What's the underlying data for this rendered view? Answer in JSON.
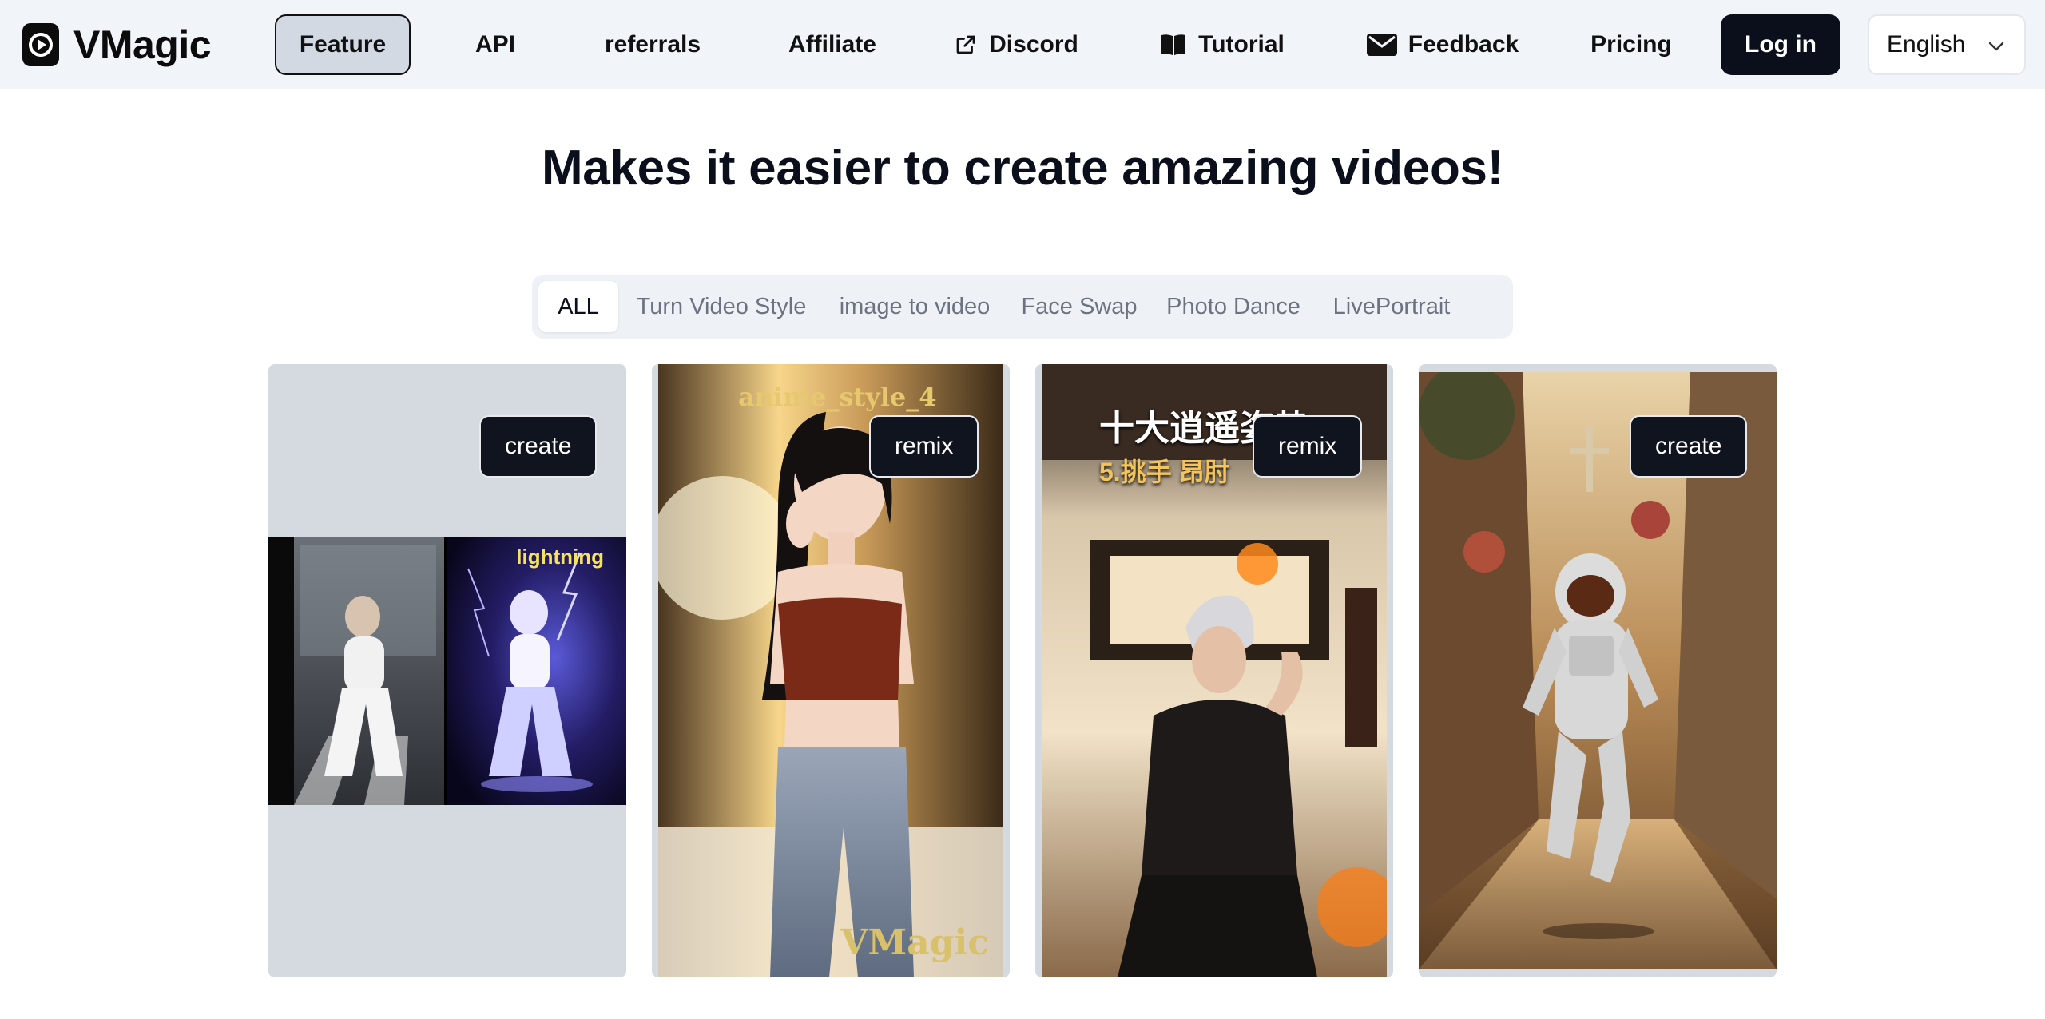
{
  "header": {
    "brand": "VMagic",
    "nav": [
      {
        "label": "Feature",
        "icon": ""
      },
      {
        "label": "API",
        "icon": ""
      },
      {
        "label": "referrals",
        "icon": ""
      },
      {
        "label": "Affiliate",
        "icon": ""
      },
      {
        "label": "Discord",
        "icon": "external-link-icon"
      },
      {
        "label": "Tutorial",
        "icon": "book-icon"
      },
      {
        "label": "Feedback",
        "icon": "mail-icon"
      },
      {
        "label": "Pricing",
        "icon": ""
      }
    ],
    "login_label": "Log in",
    "language": "English"
  },
  "hero": {
    "title": "Makes it easier to create amazing videos!"
  },
  "tabs": [
    "ALL",
    "Turn Video Style",
    "image to video",
    "Face Swap",
    "Photo Dance",
    "LivePortrait"
  ],
  "cards": [
    {
      "button": "create",
      "overlay": "lightning"
    },
    {
      "button": "remix",
      "overlay_top": "anime_style_4",
      "overlay_bottom": "VMagic"
    },
    {
      "button": "remix",
      "overlay_top": "十大逍遥姿势",
      "overlay_sub": "5.挑手 昂肘"
    },
    {
      "button": "create"
    }
  ],
  "colors": {
    "header_bg": "#f1f4f9",
    "primary_dark": "#0b0f1c",
    "active_nav_bg": "#d3d9e2",
    "tabs_bg": "#eef1f5",
    "muted_text": "#6b7280"
  }
}
